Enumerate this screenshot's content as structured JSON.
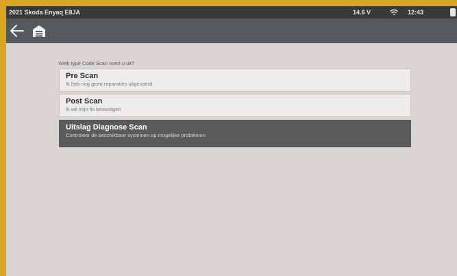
{
  "status_bar": {
    "title": "2021 Skoda Enyaq E8JA",
    "voltage": "14.6 V",
    "time": "12:43",
    "wifi_icon": "wifi-icon",
    "battery_icon": "battery-icon"
  },
  "toolbar": {
    "back_icon": "back-arrow-icon",
    "home_icon": "garage-home-icon"
  },
  "main": {
    "question": "Welk type Code Scan voert u uit?",
    "options": [
      {
        "label": "Pre Scan",
        "description": "Ik heb nog geen reparaties uitgevoerd",
        "selected": false
      },
      {
        "label": "Post Scan",
        "description": "Ik wil mijn fix bevestigen",
        "selected": false
      },
      {
        "label": "Uitslag Diagnose Scan",
        "description": "Controleer de beschikbare systemen op mogelijke problemen",
        "selected": true
      }
    ]
  },
  "colors": {
    "frame": "#d9a520",
    "background": "#d8d4d2",
    "status_bar": "#3a3a3a",
    "toolbar": "#54595b",
    "selected_option": "#5a5a5a"
  }
}
